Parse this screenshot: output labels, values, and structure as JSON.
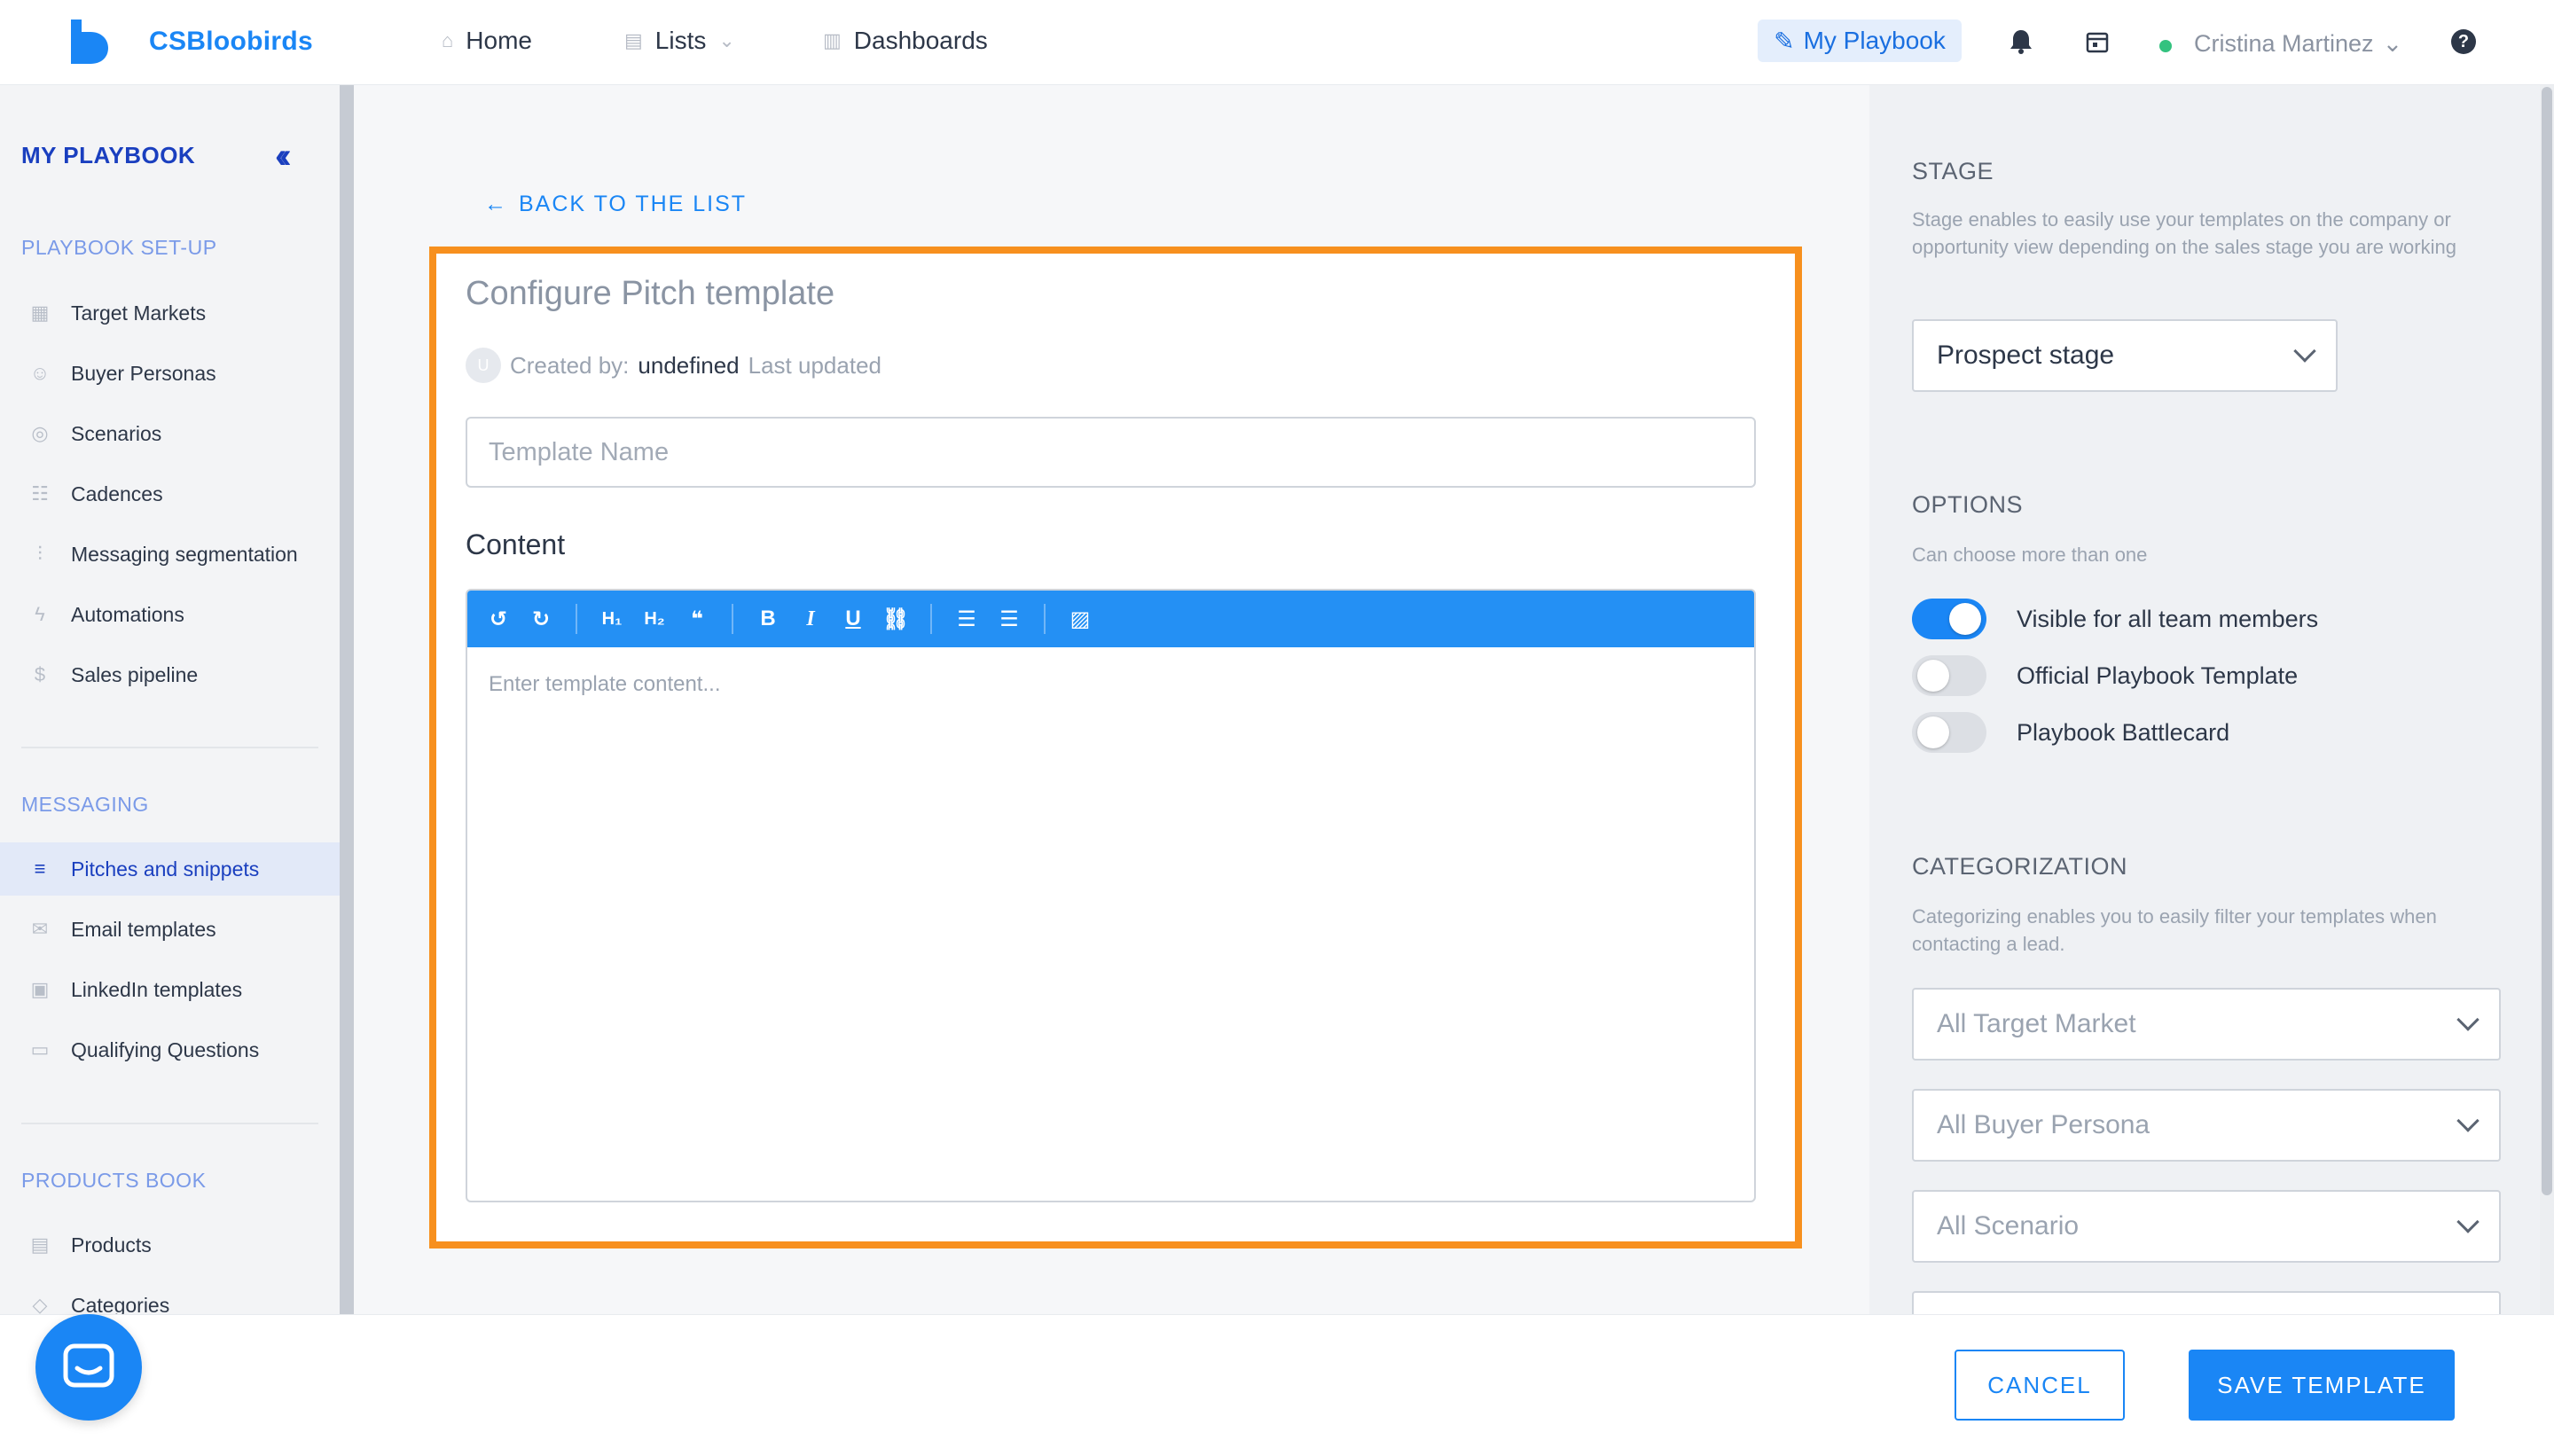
{
  "app": {
    "brand": "CSBloobirds"
  },
  "nav": {
    "home": "Home",
    "lists": "Lists",
    "dashboards": "Dashboards",
    "playbook": "My Playbook",
    "user": "Cristina Martinez",
    "help": "?"
  },
  "sidebar": {
    "title": "MY PLAYBOOK",
    "setup_label": "PLAYBOOK SET-UP",
    "setup_items": [
      {
        "label": "Target Markets",
        "icon": "building-icon"
      },
      {
        "label": "Buyer Personas",
        "icon": "users-icon"
      },
      {
        "label": "Scenarios",
        "icon": "compass-icon"
      },
      {
        "label": "Cadences",
        "icon": "cadence-icon"
      },
      {
        "label": "Messaging segmentation",
        "icon": "sliders-icon"
      },
      {
        "label": "Automations",
        "icon": "lightning-icon"
      },
      {
        "label": "Sales pipeline",
        "icon": "dollar-icon"
      }
    ],
    "messaging_label": "MESSAGING",
    "messaging_items": [
      {
        "label": "Pitches and snippets",
        "icon": "lines-icon",
        "active": true
      },
      {
        "label": "Email templates",
        "icon": "mail-icon"
      },
      {
        "label": "LinkedIn templates",
        "icon": "linkedin-icon"
      },
      {
        "label": "Qualifying Questions",
        "icon": "chat-icon"
      }
    ],
    "products_label": "PRODUCTS BOOK",
    "products_items": [
      {
        "label": "Products",
        "icon": "document-icon"
      },
      {
        "label": "Categories",
        "icon": "tag-icon"
      }
    ]
  },
  "main": {
    "back": "BACK TO THE LIST",
    "title": "Configure Pitch template",
    "created_by_label": "Created by:",
    "created_by_value": "undefined",
    "last_updated_label": "Last updated",
    "name_placeholder": "Template Name",
    "content_label": "Content",
    "editor_placeholder": "Enter template content..."
  },
  "right": {
    "stage_heading": "STAGE",
    "stage_desc": "Stage enables to easily use your templates on the company or opportunity view depending on the sales stage you are working",
    "stage_value": "Prospect stage",
    "options_heading": "OPTIONS",
    "options_desc": "Can choose more than one",
    "options": [
      {
        "label": "Visible for all team members",
        "on": true
      },
      {
        "label": "Official Playbook Template",
        "on": false
      },
      {
        "label": "Playbook Battlecard",
        "on": false
      }
    ],
    "cat_heading": "CATEGORIZATION",
    "cat_desc": "Categorizing enables you to easily filter your templates when contacting a lead.",
    "cat_selects": [
      "All Target Market",
      "All Buyer Persona",
      "All Scenario"
    ]
  },
  "footer": {
    "cancel": "CANCEL",
    "save": "SAVE TEMPLATE"
  },
  "colors": {
    "accent": "#1a86f5",
    "highlight": "#f7901e",
    "toolbar": "#2490f4"
  }
}
